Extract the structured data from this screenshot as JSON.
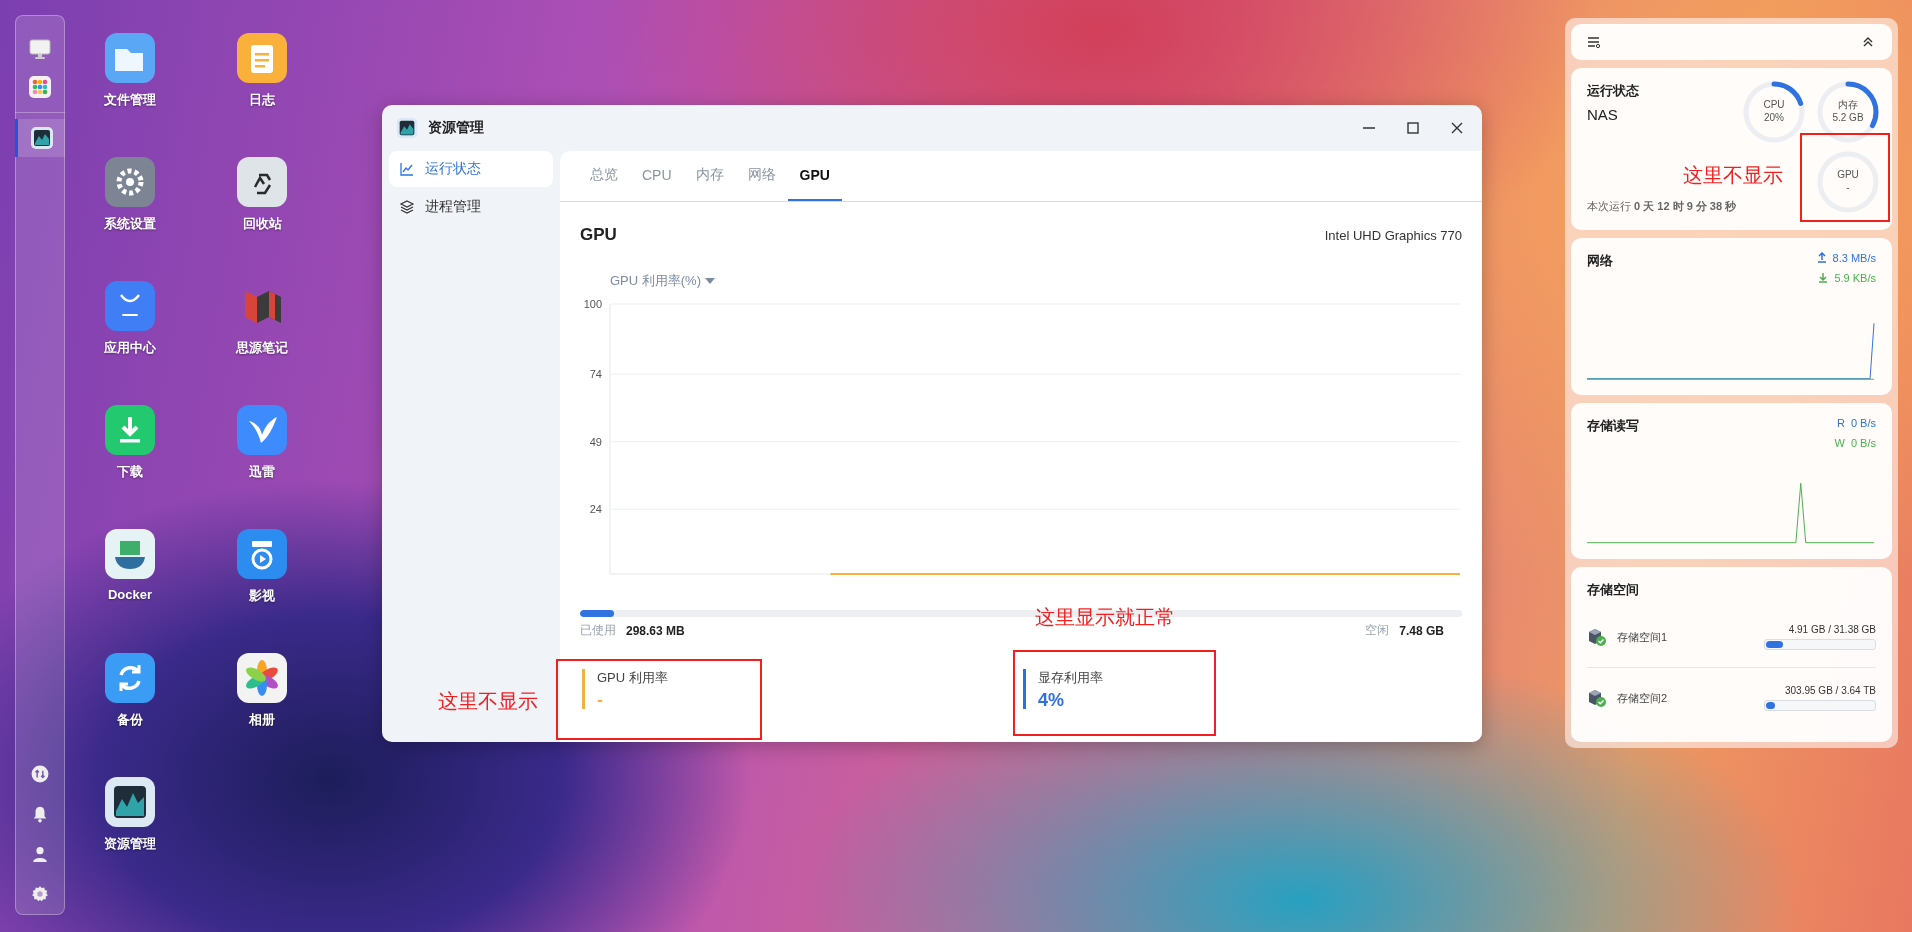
{
  "dock": {
    "items": [
      {
        "selected": false
      },
      {
        "selected": false
      },
      {
        "selected": true
      }
    ]
  },
  "desktop_apps": [
    {
      "name": "文件管理",
      "color": "#5aa8f5"
    },
    {
      "name": "日志",
      "color": "#f9b13c"
    },
    {
      "name": "系统设置",
      "color": "#7d8594"
    },
    {
      "name": "回收站",
      "color": "#dfe4e8"
    },
    {
      "name": "应用中心",
      "color": "#3f7ef5"
    },
    {
      "name": "思源笔记",
      "color": "#d9443a"
    },
    {
      "name": "下载",
      "color": "#22c96e"
    },
    {
      "name": "迅雷",
      "color": "#3d8bfd"
    },
    {
      "name": "Docker",
      "color": "#e6f3f5"
    },
    {
      "name": "影视",
      "color": "#2d8cf0"
    },
    {
      "name": "备份",
      "color": "#3a9cf5"
    },
    {
      "name": "相册",
      "color": "#f3f3f3"
    },
    {
      "name": "资源管理",
      "color": "#dde8f5"
    }
  ],
  "window": {
    "title": "资源管理",
    "sidebar": {
      "items": [
        {
          "label": "运行状态",
          "selected": true
        },
        {
          "label": "进程管理",
          "selected": false
        }
      ]
    },
    "tabs": [
      {
        "label": "总览",
        "selected": false
      },
      {
        "label": "CPU",
        "selected": false
      },
      {
        "label": "内存",
        "selected": false
      },
      {
        "label": "网络",
        "selected": false
      },
      {
        "label": "GPU",
        "selected": true
      }
    ],
    "heading": "GPU",
    "device": "Intel UHD Graphics 770",
    "chart": {
      "chart_data": {
        "type": "line",
        "grid": true,
        "ylim": [
          0,
          100
        ],
        "yticks": [
          24,
          49,
          74,
          100
        ],
        "series": [
          {
            "name": "GPU 利用率(%)",
            "color": "#f5b041",
            "values": [
              null,
              null,
              null,
              null,
              null,
              null,
              null,
              0,
              0,
              0,
              0,
              0,
              0,
              0,
              0,
              0,
              0,
              0,
              0,
              0,
              0,
              0,
              0,
              0,
              0,
              0,
              0,
              0
            ]
          }
        ]
      }
    },
    "memory": {
      "level": 0.038,
      "used_label": "已使用",
      "used": "298.63 MB",
      "free_label": "空闲",
      "free": "7.48 GB"
    },
    "stats": [
      {
        "label": "GPU 利用率",
        "value": "-",
        "color": "#f5b041"
      },
      {
        "label": "显存利用率",
        "value": "4%",
        "color": "#2f6fe0"
      }
    ]
  },
  "widgets": {
    "status": {
      "title": "运行状态",
      "host": "NAS",
      "uptime": "本次运行 **0 天 12 时 9 分 38 秒**",
      "rings": [
        {
          "label": "CPU",
          "value": "20%",
          "level": 0.2
        },
        {
          "label": "内存",
          "value": "5.2 GB",
          "level": 0.33
        },
        {
          "label": "GPU",
          "value": "-"
        }
      ]
    },
    "network": {
      "title": "网络",
      "up": "8.3 MB/s",
      "down": "5.9 KB/s"
    },
    "disk_io": {
      "title": "存储读写",
      "read": "R  0 B/s",
      "write": "W  0 B/s"
    },
    "storage": {
      "title": "存储空间",
      "items": [
        {
          "name": "存储空间1",
          "usage": "4.91 GB / 31.38 GB",
          "level": 0.156
        },
        {
          "name": "存储空间2",
          "usage": "303.95 GB / 3.64 TB",
          "level": 0.083
        }
      ]
    }
  },
  "annotations": [
    {
      "text": "这里不显示"
    },
    {
      "text": "这里显示就正常"
    },
    {
      "text": "这里不显示"
    }
  ]
}
